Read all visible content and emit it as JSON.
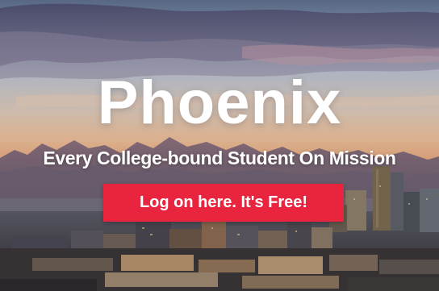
{
  "hero": {
    "title": "Phoenix",
    "tagline": "Every College-bound Student On Mission",
    "cta_label": "Log on here. It's Free!",
    "background": "phoenix-skyline-sunset",
    "colors": {
      "cta": "#e8243f",
      "text": "#ffffff"
    }
  }
}
